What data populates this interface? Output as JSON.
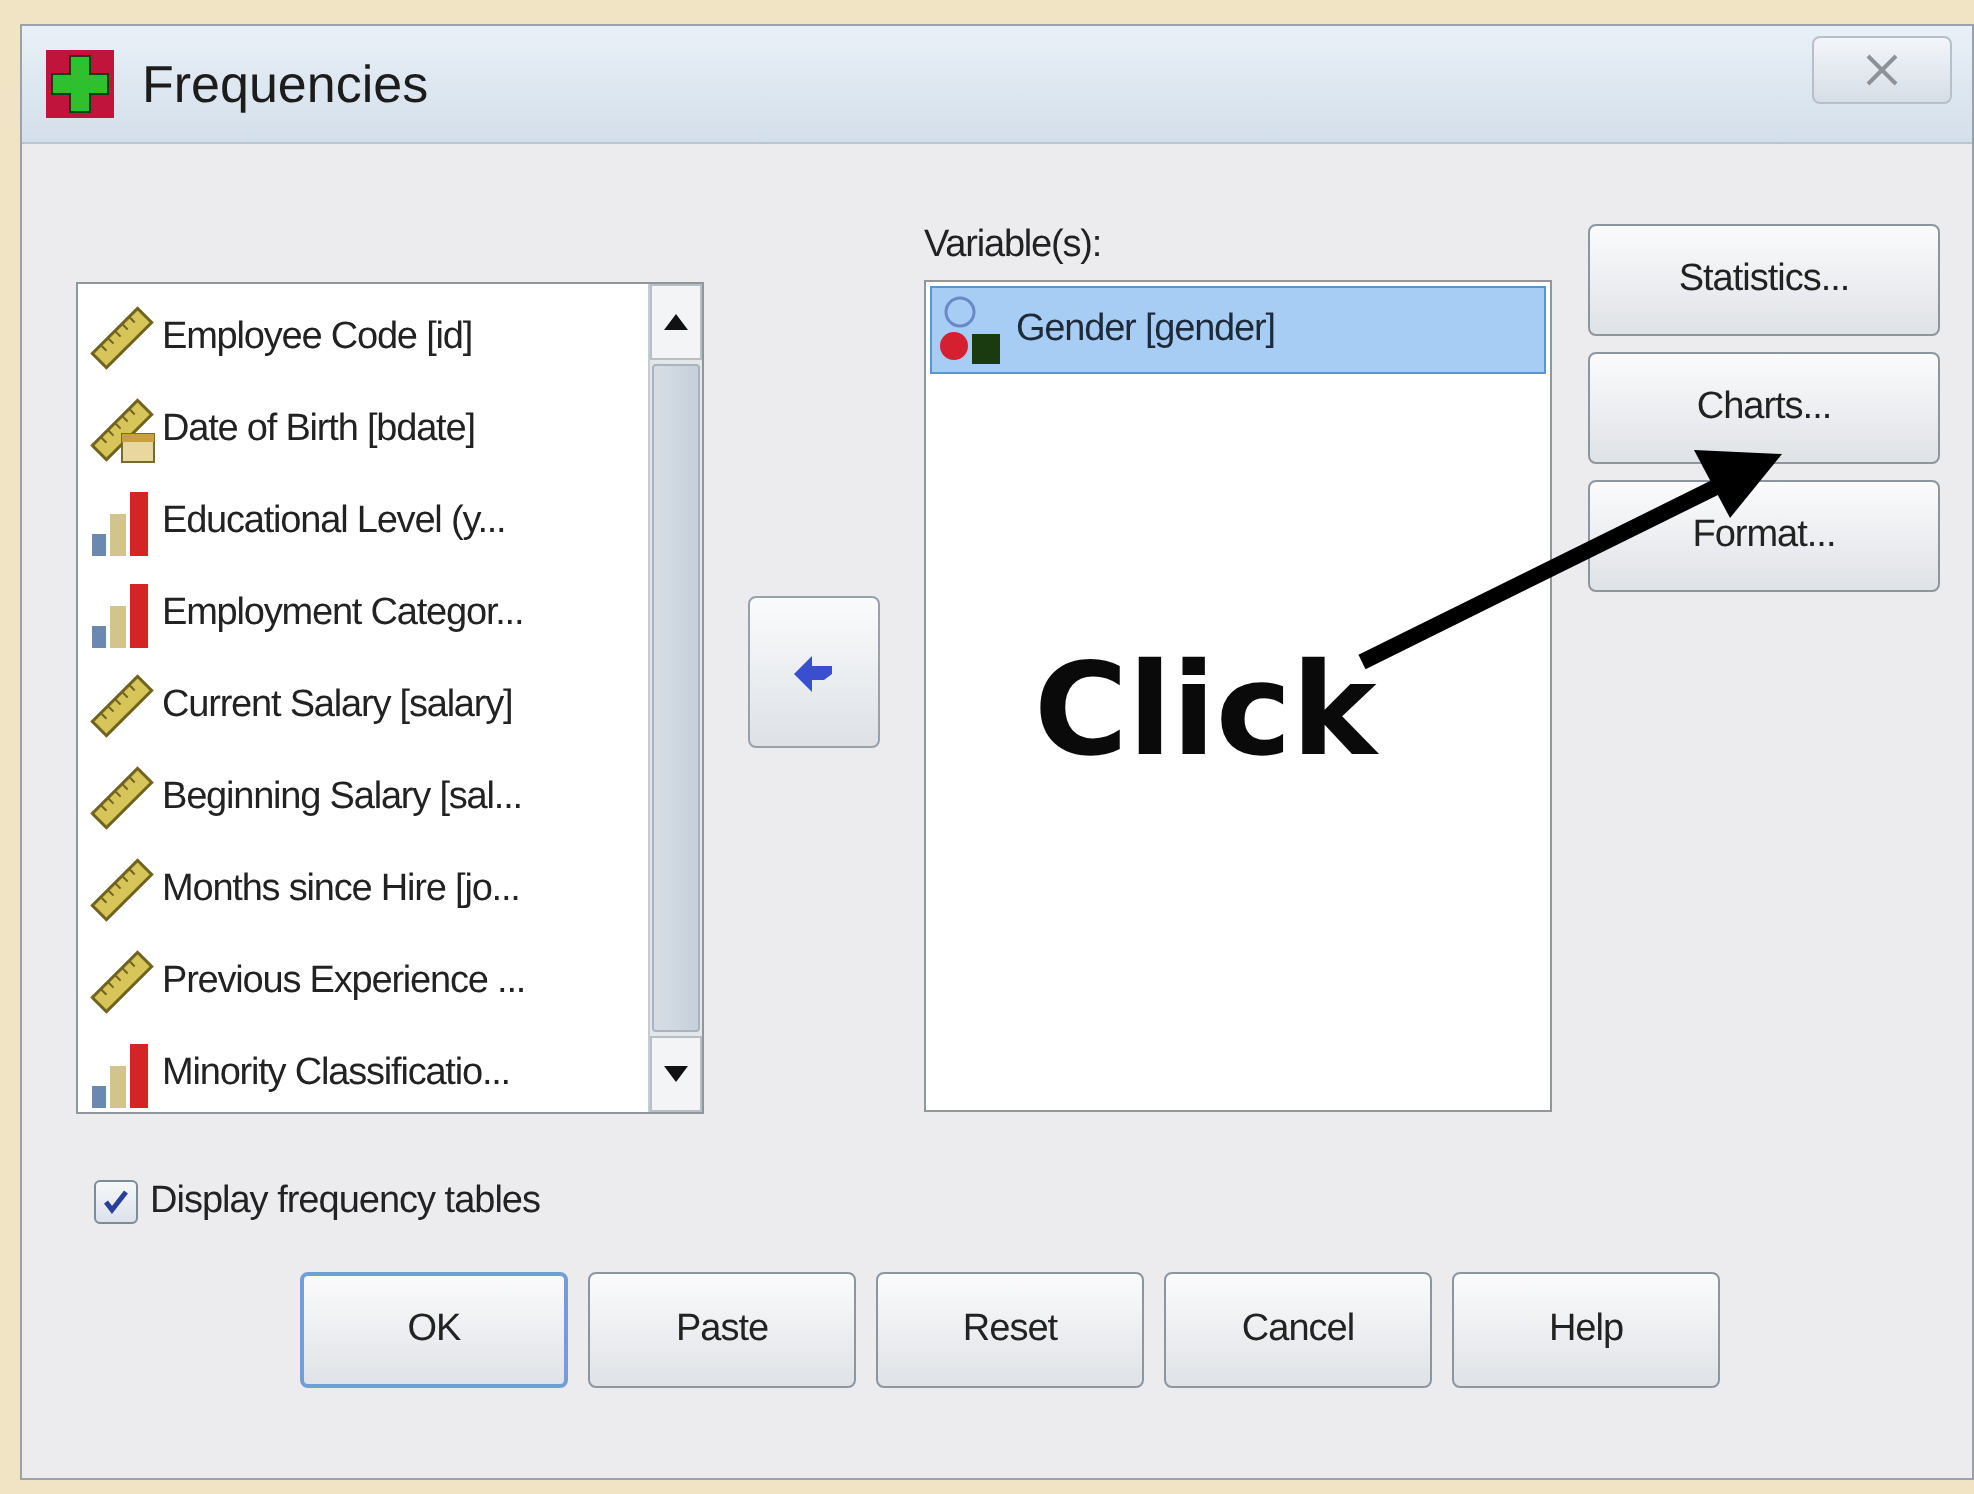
{
  "window": {
    "title": "Frequencies"
  },
  "source_list": {
    "items": [
      {
        "label": "Employee Code [id]",
        "kind": "scale"
      },
      {
        "label": "Date of Birth [bdate]",
        "kind": "date"
      },
      {
        "label": "Educational Level (y...",
        "kind": "ordinal"
      },
      {
        "label": "Employment Categor...",
        "kind": "ordinal"
      },
      {
        "label": "Current Salary [salary]",
        "kind": "scale"
      },
      {
        "label": "Beginning Salary [sal...",
        "kind": "scale"
      },
      {
        "label": "Months since Hire [jo...",
        "kind": "scale"
      },
      {
        "label": "Previous Experience ...",
        "kind": "scale"
      },
      {
        "label": "Minority Classificatio...",
        "kind": "ordinal"
      }
    ]
  },
  "variables": {
    "label": "Variable(s):",
    "items": [
      {
        "label": "Gender [gender]",
        "kind": "nominal",
        "selected": true
      }
    ]
  },
  "side_buttons": [
    "Statistics...",
    "Charts...",
    "Format..."
  ],
  "display_frequency_tables": {
    "label": "Display frequency tables",
    "checked": true
  },
  "buttons": [
    {
      "label": "OK",
      "default": true
    },
    {
      "label": "Paste",
      "default": false
    },
    {
      "label": "Reset",
      "default": false
    },
    {
      "label": "Cancel",
      "default": false
    },
    {
      "label": "Help",
      "default": false
    }
  ],
  "annotation": {
    "text": "Click"
  }
}
